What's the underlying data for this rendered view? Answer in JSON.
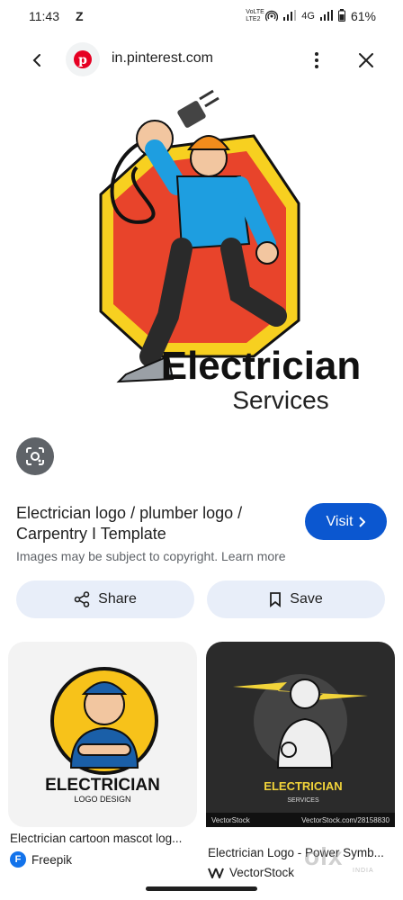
{
  "status": {
    "time": "11:43",
    "extra": "Z",
    "network_label": "VoLTE LTE2",
    "net_type": "4G",
    "battery": "61%"
  },
  "browser": {
    "url": "in.pinterest.com"
  },
  "hero": {
    "logo_word": "Electrician",
    "logo_sub": "Services"
  },
  "result": {
    "title": "Electrician logo / plumber logo / Carpentry I Template",
    "visit_label": "Visit",
    "copyright": "Images may be subject to copyright. Learn more",
    "share_label": "Share",
    "save_label": "Save"
  },
  "related": [
    {
      "caption": "Electrician cartoon mascot log...",
      "source": "Freepik",
      "logo_word": "ELECTRICIAN",
      "logo_sub": "LOGO DESIGN"
    },
    {
      "caption": "Electrician Logo - Power Symb...",
      "source": "VectorStock",
      "logo_word": "ELECTRICIAN",
      "logo_sub": "SERVICES",
      "strip_left": "VectorStock",
      "strip_right": "VectorStock.com/28158830"
    }
  ],
  "watermark": {
    "brand": "olx",
    "sub": "INDIA"
  },
  "colors": {
    "accent": "#0b57d0",
    "chip_bg": "#e8eef9",
    "pinterest": "#e60023"
  }
}
